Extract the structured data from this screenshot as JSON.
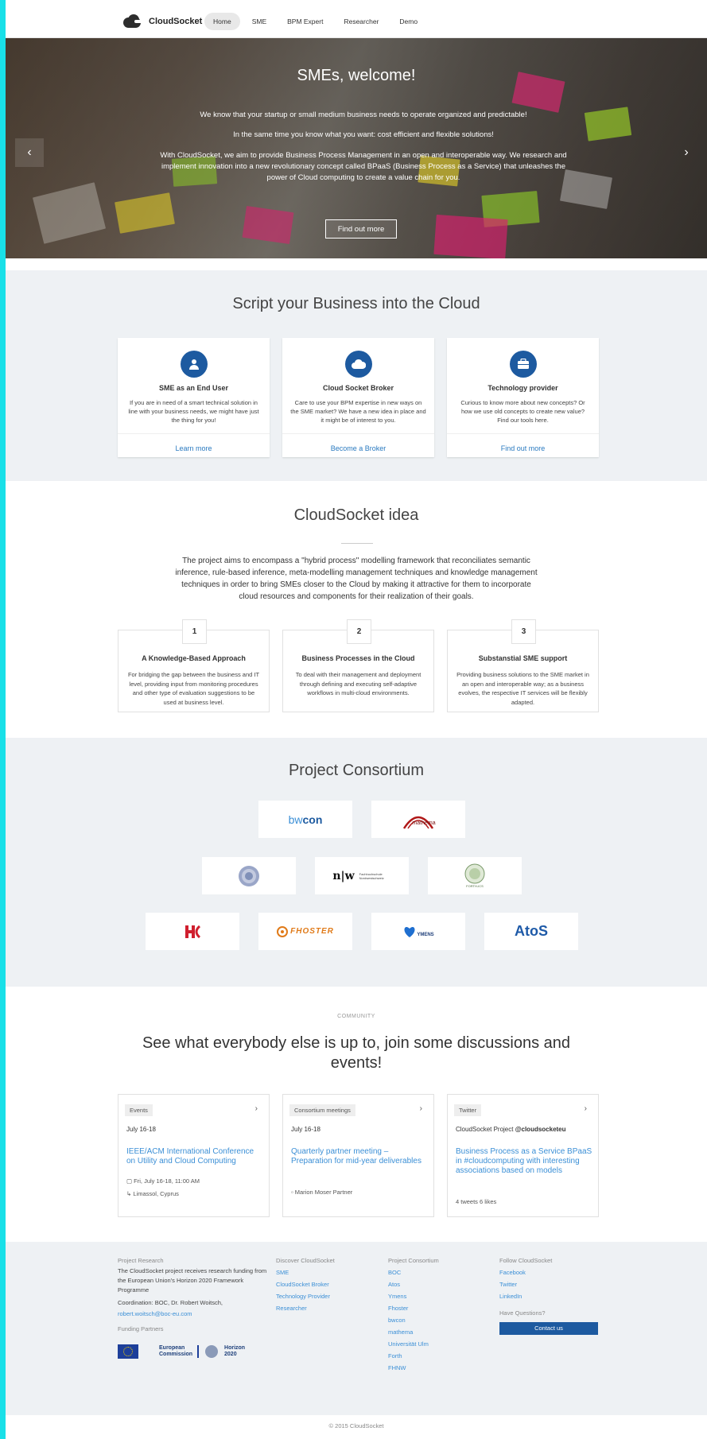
{
  "nav": {
    "brand": "CloudSocket",
    "items": [
      "Home",
      "SME",
      "BPM Expert",
      "Researcher",
      "Demo"
    ],
    "active": "Home"
  },
  "hero": {
    "title": "SMEs, welcome!",
    "p1": "We know that your startup or small medium business needs to operate organized and predictable!",
    "p2": "In the same time you know what you want: cost efficient and flexible solutions!",
    "p3": "With CloudSocket, we aim to provide Business Process Management in an open and interoperable way. We research and implement innovation into a new revolutionary concept called BPaaS (Business Process as a Service) that unleashes the power of Cloud computing to create a value chain for you.",
    "button": "Find out more",
    "prev": "‹",
    "next": "›"
  },
  "script_section": {
    "title": "Script your Business into the Cloud",
    "cards": [
      {
        "icon": "user-icon",
        "title": "SME as an End User",
        "text": "If you are in need of a smart technical solution in line with your business needs, we might have just the thing for you!",
        "link": "Learn more"
      },
      {
        "icon": "cloud-icon",
        "title": "Cloud Socket Broker",
        "text": "Care to use your BPM expertise in new ways on the SME market? We have a new idea in place and it might be of interest to you.",
        "link": "Become a Broker"
      },
      {
        "icon": "briefcase-icon",
        "title": "Technology provider",
        "text": "Curious to know more about new concepts? Or how we use old concepts to create new value? Find our tools here.",
        "link": "Find out more"
      }
    ]
  },
  "idea": {
    "title": "CloudSocket idea",
    "text": "The project aims to encompass a \"hybrid process\" modelling framework that reconciliates semantic inference, rule-based inference, meta-modelling management techniques and knowledge management techniques in order to bring SMEs closer to the Cloud by making it attractive for them to incorporate cloud resources and components for their realization of their goals.",
    "boxes": [
      {
        "num": "1",
        "title": "A Knowledge-Based Approach",
        "text": "For bridging the gap between the business and IT level, providing input from monitoring procedures and other type of evaluation suggestions to be used at business level."
      },
      {
        "num": "2",
        "title": "Business Processes in the Cloud",
        "text": "To deal with their management and deployment through defining and executing self-adaptive workflows in multi-cloud environments."
      },
      {
        "num": "3",
        "title": "Substanstial SME support",
        "text": "Providing business solutions to the SME market in an open and interoperable way; as a business evolves, the respective IT services will be flexibly adapted."
      }
    ]
  },
  "consortium": {
    "title": "Project Consortium",
    "logos": {
      "bwcon_a": "bw",
      "bwcon_b": "con",
      "mathema": "mathema",
      "fhnw_a": "n|w",
      "fhnw_b": "Fachhochschule Nordwestschweiz",
      "forth": "FORTH-ICS",
      "fhoster": "FHOSTER",
      "ymens": "YMENS",
      "atos": "AtoS"
    }
  },
  "community": {
    "label": "COMMUNITY",
    "title": "See what everybody else is up to, join some discussions and events!",
    "feeds": [
      {
        "tag": "Events",
        "date": "July 16-18",
        "link": "IEEE/ACM International Conference on Utility and Cloud Computing",
        "meta1": "Fri, July 16-18, 11:00 AM",
        "meta2": "Limassol, Cyprus"
      },
      {
        "tag": "Consortium meetings",
        "date": "July 16-18",
        "link": "Quarterly partner meeting – Preparation for mid-year deliverables",
        "meta1": "Marion Moser Partner"
      },
      {
        "tag": "Twitter",
        "date_a": "CloudSocket Project ",
        "date_b": "@cloudsocketeu",
        "link": "Business Process as a Service BPaaS in #cloudcomputing with interesting associations based on models",
        "meta1": "4 tweets 6 likes"
      }
    ]
  },
  "footer": {
    "col1": {
      "heading": "Project Research",
      "text": "The CloudSocket project receives research funding from the European Union's Horizon 2020 Framework Programme",
      "coord": "Coordination: BOC, Dr. Robert Woitsch,",
      "email": "robert.woitsch@boc-eu.com",
      "funding": "Funding Partners",
      "ec_a": "European",
      "ec_b": "Commission",
      "h2020_a": "Horizon",
      "h2020_b": "2020"
    },
    "col2": {
      "heading": "Discover CloudSocket",
      "links": [
        "SME",
        "CloudSocket Broker",
        "Technology Provider",
        "Researcher"
      ]
    },
    "col3": {
      "heading": "Project Consortium",
      "links": [
        "BOC",
        "Atos",
        "Ymens",
        "Fhoster",
        "bwcon",
        "mathema",
        "Universität Ulm",
        "Forth",
        "FHNW"
      ]
    },
    "col4": {
      "heading": "Follow CloudSocket",
      "links": [
        "Facebook",
        "Twitter",
        "LinkedIn"
      ],
      "question": "Have Questions?",
      "contact": "Contact us"
    },
    "copyright": "© 2015 CloudSocket"
  },
  "colors": {
    "accent": "#1d5aa0",
    "link": "#3b8fd6",
    "section_gray": "#eef1f4",
    "edge": "#19e0e8"
  }
}
